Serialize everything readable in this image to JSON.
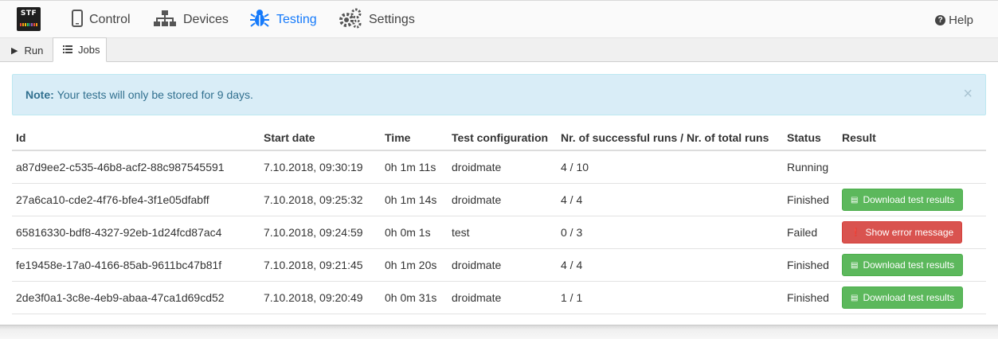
{
  "logo": {
    "text": "STF"
  },
  "nav": {
    "items": [
      {
        "label": "Control",
        "icon": "mobile-phone-icon",
        "active": false
      },
      {
        "label": "Devices",
        "icon": "sitemap-icon",
        "active": false
      },
      {
        "label": "Testing",
        "icon": "bug-icon",
        "active": true
      },
      {
        "label": "Settings",
        "icon": "gears-icon",
        "active": false
      }
    ],
    "help": "Help"
  },
  "subtabs": [
    {
      "label": "Run",
      "icon": "play-icon",
      "selected": false
    },
    {
      "label": "Jobs",
      "icon": "list-icon",
      "selected": true
    }
  ],
  "alert": {
    "strong": "Note:",
    "text": "Your tests will only be stored for 9 days.",
    "close": "×"
  },
  "table": {
    "headers": [
      "Id",
      "Start date",
      "Time",
      "Test configuration",
      "Nr. of successful runs / Nr. of total runs",
      "Status",
      "Result"
    ],
    "rows": [
      {
        "id": "a87d9ee2-c535-46b8-acf2-88c987545591",
        "start": "7.10.2018, 09:30:19",
        "time": "0h 1m 11s",
        "config": "droidmate",
        "runs": "4 / 10",
        "status": "Running",
        "result": ""
      },
      {
        "id": "27a6ca10-cde2-4f76-bfe4-3f1e05dfabff",
        "start": "7.10.2018, 09:25:32",
        "time": "0h 1m 14s",
        "config": "droidmate",
        "runs": "4 / 4",
        "status": "Finished",
        "result": "Download test results"
      },
      {
        "id": "65816330-bdf8-4327-92eb-1d24fcd87ac4",
        "start": "7.10.2018, 09:24:59",
        "time": "0h 0m 1s",
        "config": "test",
        "runs": "0 / 3",
        "status": "Failed",
        "result": "Show error message"
      },
      {
        "id": "fe19458e-17a0-4166-85ab-9611bc47b81f",
        "start": "7.10.2018, 09:21:45",
        "time": "0h 1m 20s",
        "config": "droidmate",
        "runs": "4 / 4",
        "status": "Finished",
        "result": "Download test results"
      },
      {
        "id": "2de3f0a1-3c8e-4eb9-abaa-47ca1d69cd52",
        "start": "7.10.2018, 09:20:49",
        "time": "0h 0m 31s",
        "config": "droidmate",
        "runs": "1 / 1",
        "status": "Finished",
        "result": "Download test results"
      }
    ]
  },
  "colors": {
    "accent": "#157afb",
    "success": "#5cb85c",
    "danger": "#d9534f",
    "info_bg": "#d9edf7"
  }
}
